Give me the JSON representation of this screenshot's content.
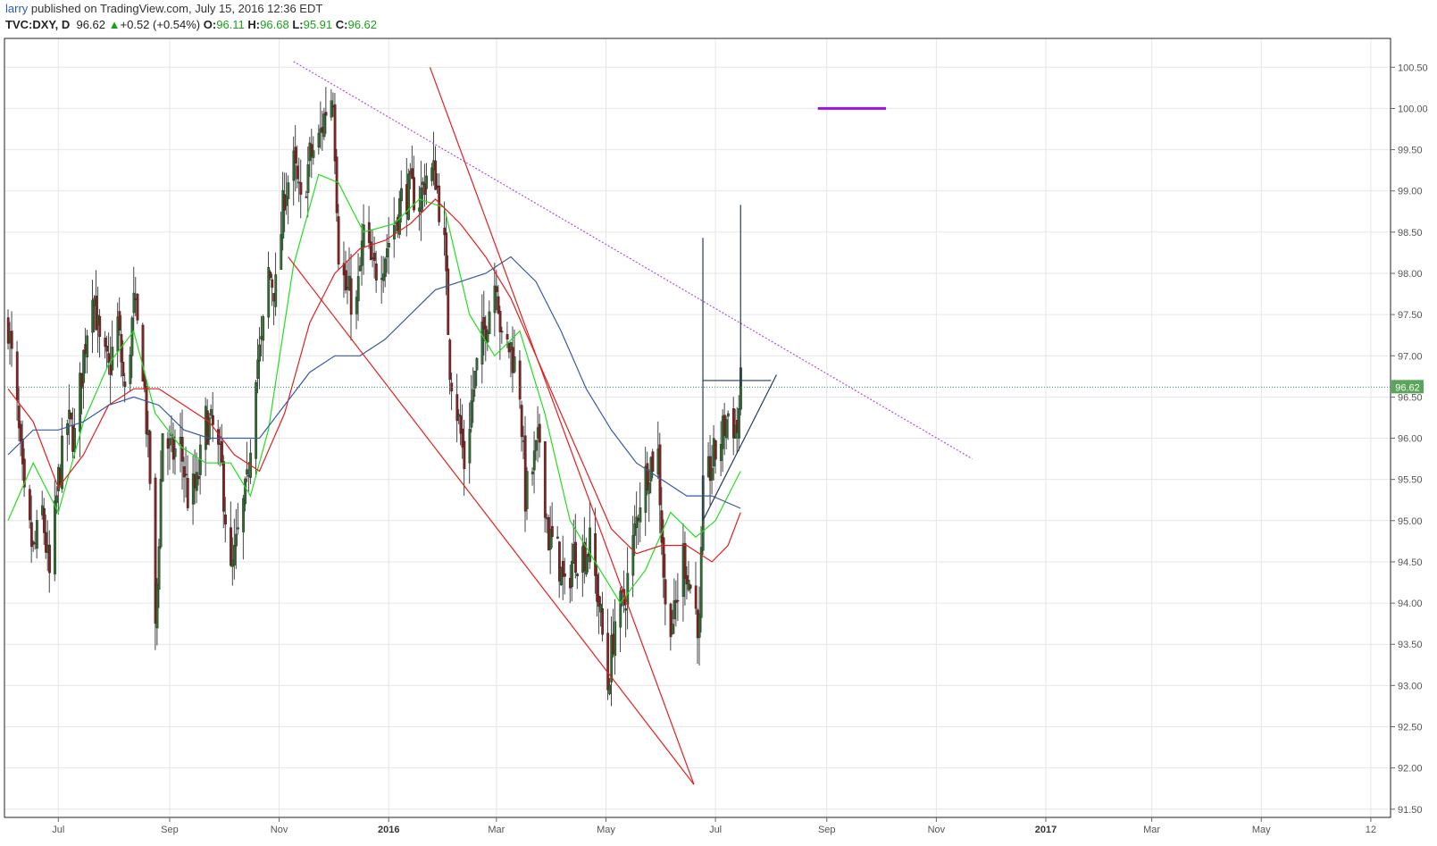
{
  "header": {
    "user": "larry",
    "published": " published on TradingView.com, July 15, 2016 12:36 EDT",
    "symbol": "TVC:DXY, D",
    "last": "96.62",
    "change": "+0.52 (+0.54%)",
    "open_label": "O:",
    "open": "96.11",
    "high_label": "H:",
    "high": "96.68",
    "low_label": "L:",
    "low": "95.91",
    "close_label": "C:",
    "close": "96.62"
  },
  "colors": {
    "up": "#2d6f2d",
    "down": "#8b1f1f",
    "ma_fast": "#22dd22",
    "ma_mid": "#e02020",
    "ma_slow": "#3a5aa0",
    "trend_red": "#e02020",
    "trend_purple": "#b04ee0",
    "structure": "#233b5e",
    "last_price_bg": "#5aa55a",
    "marker": "#9a14e0"
  },
  "chart_data": {
    "type": "candlestick",
    "symbol": "TVC:DXY",
    "interval": "D",
    "ylim": [
      91.4,
      100.85
    ],
    "y_ticks": [
      "100.50",
      "100.00",
      "99.50",
      "99.00",
      "98.50",
      "98.00",
      "97.50",
      "97.00",
      "96.50",
      "96.00",
      "95.50",
      "95.00",
      "94.50",
      "94.00",
      "93.50",
      "93.00",
      "92.50",
      "92.00",
      "91.50"
    ],
    "x_ticks": [
      {
        "label": "Jul",
        "bold": false,
        "date": "2015-07-01"
      },
      {
        "label": "Sep",
        "bold": false,
        "date": "2015-09-01"
      },
      {
        "label": "Nov",
        "bold": false,
        "date": "2015-11-01"
      },
      {
        "label": "2016",
        "bold": true,
        "date": "2016-01-01"
      },
      {
        "label": "Mar",
        "bold": false,
        "date": "2016-03-01"
      },
      {
        "label": "May",
        "bold": false,
        "date": "2016-05-01"
      },
      {
        "label": "Jul",
        "bold": false,
        "date": "2016-07-01"
      },
      {
        "label": "Sep",
        "bold": false,
        "date": "2016-09-01"
      },
      {
        "label": "Nov",
        "bold": false,
        "date": "2016-11-01"
      },
      {
        "label": "2017",
        "bold": true,
        "date": "2017-01-01"
      },
      {
        "label": "Mar",
        "bold": false,
        "date": "2017-03-01"
      },
      {
        "label": "May",
        "bold": false,
        "date": "2017-05-01"
      },
      {
        "label": "12",
        "bold": false,
        "date": "2017-07-01"
      }
    ],
    "last_price": "96.62",
    "close_path": [
      [
        "2015-06-03",
        97.4
      ],
      [
        "2015-06-08",
        96.3
      ],
      [
        "2015-06-12",
        95.2
      ],
      [
        "2015-06-17",
        94.6
      ],
      [
        "2015-06-22",
        95.1
      ],
      [
        "2015-06-26",
        94.3
      ],
      [
        "2015-07-01",
        95.5
      ],
      [
        "2015-07-06",
        96.2
      ],
      [
        "2015-07-10",
        96.0
      ],
      [
        "2015-07-15",
        97.0
      ],
      [
        "2015-07-20",
        97.9
      ],
      [
        "2015-07-24",
        97.1
      ],
      [
        "2015-07-29",
        96.8
      ],
      [
        "2015-08-03",
        97.4
      ],
      [
        "2015-08-07",
        96.5
      ],
      [
        "2015-08-12",
        97.6
      ],
      [
        "2015-08-17",
        96.9
      ],
      [
        "2015-08-21",
        95.5
      ],
      [
        "2015-08-24",
        93.6
      ],
      [
        "2015-08-28",
        96.1
      ],
      [
        "2015-09-02",
        95.8
      ],
      [
        "2015-09-07",
        95.9
      ],
      [
        "2015-09-11",
        95.3
      ],
      [
        "2015-09-16",
        95.4
      ],
      [
        "2015-09-21",
        96.2
      ],
      [
        "2015-09-25",
        96.1
      ],
      [
        "2015-09-30",
        95.6
      ],
      [
        "2015-10-05",
        94.3
      ],
      [
        "2015-10-09",
        94.8
      ],
      [
        "2015-10-14",
        95.4
      ],
      [
        "2015-10-19",
        96.9
      ],
      [
        "2015-10-22",
        97.1
      ],
      [
        "2015-10-26",
        98.0
      ],
      [
        "2015-10-30",
        97.8
      ],
      [
        "2015-11-04",
        99.0
      ],
      [
        "2015-11-09",
        99.3
      ],
      [
        "2015-11-13",
        98.8
      ],
      [
        "2015-11-18",
        99.4
      ],
      [
        "2015-11-23",
        99.6
      ],
      [
        "2015-11-27",
        100.0
      ],
      [
        "2015-12-01",
        100.2
      ],
      [
        "2015-12-04",
        98.3
      ],
      [
        "2015-12-08",
        97.8
      ],
      [
        "2015-12-14",
        97.6
      ],
      [
        "2015-12-18",
        98.5
      ],
      [
        "2015-12-23",
        98.0
      ],
      [
        "2015-12-29",
        98.2
      ],
      [
        "2016-01-04",
        98.6
      ],
      [
        "2016-01-08",
        98.9
      ],
      [
        "2016-01-13",
        99.0
      ],
      [
        "2016-01-18",
        98.9
      ],
      [
        "2016-01-22",
        99.2
      ],
      [
        "2016-01-27",
        99.2
      ],
      [
        "2016-02-01",
        98.3
      ],
      [
        "2016-02-04",
        96.9
      ],
      [
        "2016-02-09",
        96.2
      ],
      [
        "2016-02-12",
        95.7
      ],
      [
        "2016-02-17",
        96.6
      ],
      [
        "2016-02-22",
        97.2
      ],
      [
        "2016-02-26",
        97.6
      ],
      [
        "2016-03-01",
        98.0
      ],
      [
        "2016-03-04",
        97.1
      ],
      [
        "2016-03-09",
        97.1
      ],
      [
        "2016-03-14",
        96.6
      ],
      [
        "2016-03-17",
        95.3
      ],
      [
        "2016-03-22",
        95.7
      ],
      [
        "2016-03-25",
        96.0
      ],
      [
        "2016-03-30",
        94.8
      ],
      [
        "2016-04-04",
        94.6
      ],
      [
        "2016-04-08",
        94.1
      ],
      [
        "2016-04-13",
        94.6
      ],
      [
        "2016-04-18",
        94.6
      ],
      [
        "2016-04-22",
        94.7
      ],
      [
        "2016-04-27",
        94.0
      ],
      [
        "2016-05-02",
        93.0
      ],
      [
        "2016-05-06",
        93.8
      ],
      [
        "2016-05-11",
        94.0
      ],
      [
        "2016-05-16",
        94.7
      ],
      [
        "2016-05-20",
        95.3
      ],
      [
        "2016-05-25",
        95.7
      ],
      [
        "2016-05-30",
        95.8
      ],
      [
        "2016-06-03",
        93.9
      ],
      [
        "2016-06-08",
        93.8
      ],
      [
        "2016-06-13",
        94.6
      ],
      [
        "2016-06-17",
        94.2
      ],
      [
        "2016-06-22",
        93.7
      ],
      [
        "2016-06-24",
        95.3
      ],
      [
        "2016-06-29",
        95.7
      ],
      [
        "2016-07-04",
        96.0
      ],
      [
        "2016-07-08",
        96.3
      ],
      [
        "2016-07-13",
        96.1
      ],
      [
        "2016-07-15",
        96.62
      ]
    ],
    "moving_averages": [
      {
        "color_key": "ma_fast",
        "points": [
          [
            "2015-06-03",
            95.0
          ],
          [
            "2015-06-17",
            95.7
          ],
          [
            "2015-07-01",
            95.1
          ],
          [
            "2015-07-15",
            96.2
          ],
          [
            "2015-07-29",
            96.9
          ],
          [
            "2015-08-12",
            97.3
          ],
          [
            "2015-08-24",
            96.3
          ],
          [
            "2015-09-07",
            95.9
          ],
          [
            "2015-09-21",
            95.7
          ],
          [
            "2015-10-05",
            95.7
          ],
          [
            "2015-10-16",
            95.3
          ],
          [
            "2015-10-26",
            96.1
          ],
          [
            "2015-11-09",
            98.1
          ],
          [
            "2015-11-23",
            99.2
          ],
          [
            "2015-12-04",
            99.1
          ],
          [
            "2015-12-18",
            98.5
          ],
          [
            "2016-01-04",
            98.6
          ],
          [
            "2016-01-18",
            98.9
          ],
          [
            "2016-02-01",
            98.8
          ],
          [
            "2016-02-15",
            97.5
          ],
          [
            "2016-02-29",
            97.0
          ],
          [
            "2016-03-14",
            97.3
          ],
          [
            "2016-03-28",
            96.3
          ],
          [
            "2016-04-11",
            95.0
          ],
          [
            "2016-04-25",
            94.5
          ],
          [
            "2016-05-09",
            94.0
          ],
          [
            "2016-05-23",
            94.4
          ],
          [
            "2016-06-06",
            95.1
          ],
          [
            "2016-06-20",
            94.8
          ],
          [
            "2016-07-01",
            95.0
          ],
          [
            "2016-07-15",
            95.6
          ]
        ]
      },
      {
        "color_key": "ma_mid",
        "points": [
          [
            "2015-06-03",
            96.6
          ],
          [
            "2015-06-17",
            96.2
          ],
          [
            "2015-07-01",
            95.4
          ],
          [
            "2015-07-15",
            95.8
          ],
          [
            "2015-07-29",
            96.4
          ],
          [
            "2015-08-12",
            96.6
          ],
          [
            "2015-08-26",
            96.6
          ],
          [
            "2015-09-09",
            96.4
          ],
          [
            "2015-09-23",
            96.2
          ],
          [
            "2015-10-07",
            95.8
          ],
          [
            "2015-10-21",
            95.6
          ],
          [
            "2015-11-04",
            96.3
          ],
          [
            "2015-11-18",
            97.4
          ],
          [
            "2015-12-02",
            98.0
          ],
          [
            "2015-12-16",
            98.3
          ],
          [
            "2015-12-30",
            98.4
          ],
          [
            "2016-01-13",
            98.6
          ],
          [
            "2016-01-27",
            98.9
          ],
          [
            "2016-02-10",
            98.6
          ],
          [
            "2016-02-24",
            98.2
          ],
          [
            "2016-03-09",
            97.7
          ],
          [
            "2016-03-23",
            97.0
          ],
          [
            "2016-04-06",
            96.3
          ],
          [
            "2016-04-20",
            95.6
          ],
          [
            "2016-05-04",
            94.9
          ],
          [
            "2016-05-18",
            94.6
          ],
          [
            "2016-06-01",
            94.7
          ],
          [
            "2016-06-15",
            94.7
          ],
          [
            "2016-06-29",
            94.5
          ],
          [
            "2016-07-08",
            94.7
          ],
          [
            "2016-07-15",
            95.1
          ]
        ]
      },
      {
        "color_key": "ma_slow",
        "points": [
          [
            "2015-06-03",
            95.8
          ],
          [
            "2015-06-17",
            96.1
          ],
          [
            "2015-07-01",
            96.1
          ],
          [
            "2015-07-15",
            96.2
          ],
          [
            "2015-07-29",
            96.4
          ],
          [
            "2015-08-12",
            96.5
          ],
          [
            "2015-08-26",
            96.4
          ],
          [
            "2015-09-09",
            96.1
          ],
          [
            "2015-09-23",
            96.0
          ],
          [
            "2015-10-07",
            96.0
          ],
          [
            "2015-10-21",
            96.0
          ],
          [
            "2015-11-04",
            96.4
          ],
          [
            "2015-11-18",
            96.8
          ],
          [
            "2015-12-02",
            97.0
          ],
          [
            "2015-12-16",
            97.0
          ],
          [
            "2015-12-30",
            97.2
          ],
          [
            "2016-01-13",
            97.5
          ],
          [
            "2016-01-27",
            97.8
          ],
          [
            "2016-02-10",
            97.9
          ],
          [
            "2016-02-24",
            98.0
          ],
          [
            "2016-03-09",
            98.2
          ],
          [
            "2016-03-23",
            97.9
          ],
          [
            "2016-04-06",
            97.3
          ],
          [
            "2016-04-20",
            96.6
          ],
          [
            "2016-05-04",
            96.1
          ],
          [
            "2016-05-18",
            95.7
          ],
          [
            "2016-06-01",
            95.5
          ],
          [
            "2016-06-15",
            95.3
          ],
          [
            "2016-06-29",
            95.3
          ],
          [
            "2016-07-15",
            95.15
          ]
        ]
      }
    ],
    "drawings": [
      {
        "kind": "line",
        "style": "solid",
        "color_key": "trend_red",
        "from": [
          "2015-11-06",
          98.2
        ],
        "to": [
          "2016-06-19",
          91.8
        ]
      },
      {
        "kind": "line",
        "style": "solid",
        "color_key": "trend_red",
        "from": [
          "2016-01-24",
          100.5
        ],
        "to": [
          "2016-06-19",
          91.8
        ]
      },
      {
        "kind": "line",
        "style": "dotted",
        "color_key": "trend_purple",
        "from": [
          "2015-11-09",
          100.57
        ],
        "to": [
          "2016-11-21",
          95.75
        ]
      },
      {
        "kind": "line",
        "style": "solid",
        "color_key": "structure",
        "from": [
          "2016-06-24",
          98.43
        ],
        "to": [
          "2016-06-24",
          95.0
        ]
      },
      {
        "kind": "line",
        "style": "solid",
        "color_key": "structure",
        "from": [
          "2016-07-15",
          98.83
        ],
        "to": [
          "2016-07-15",
          96.62
        ]
      },
      {
        "kind": "line",
        "style": "solid",
        "color_key": "structure",
        "from": [
          "2016-06-24",
          96.7
        ],
        "to": [
          "2016-08-01",
          96.7
        ]
      },
      {
        "kind": "line",
        "style": "solid",
        "color_key": "structure",
        "from": [
          "2016-06-24",
          95.0
        ],
        "to": [
          "2016-08-04",
          96.77
        ]
      },
      {
        "kind": "line",
        "style": "solid",
        "color_key": "marker",
        "from": [
          "2016-08-27",
          100.0
        ],
        "to": [
          "2016-10-04",
          100.0
        ]
      }
    ]
  }
}
